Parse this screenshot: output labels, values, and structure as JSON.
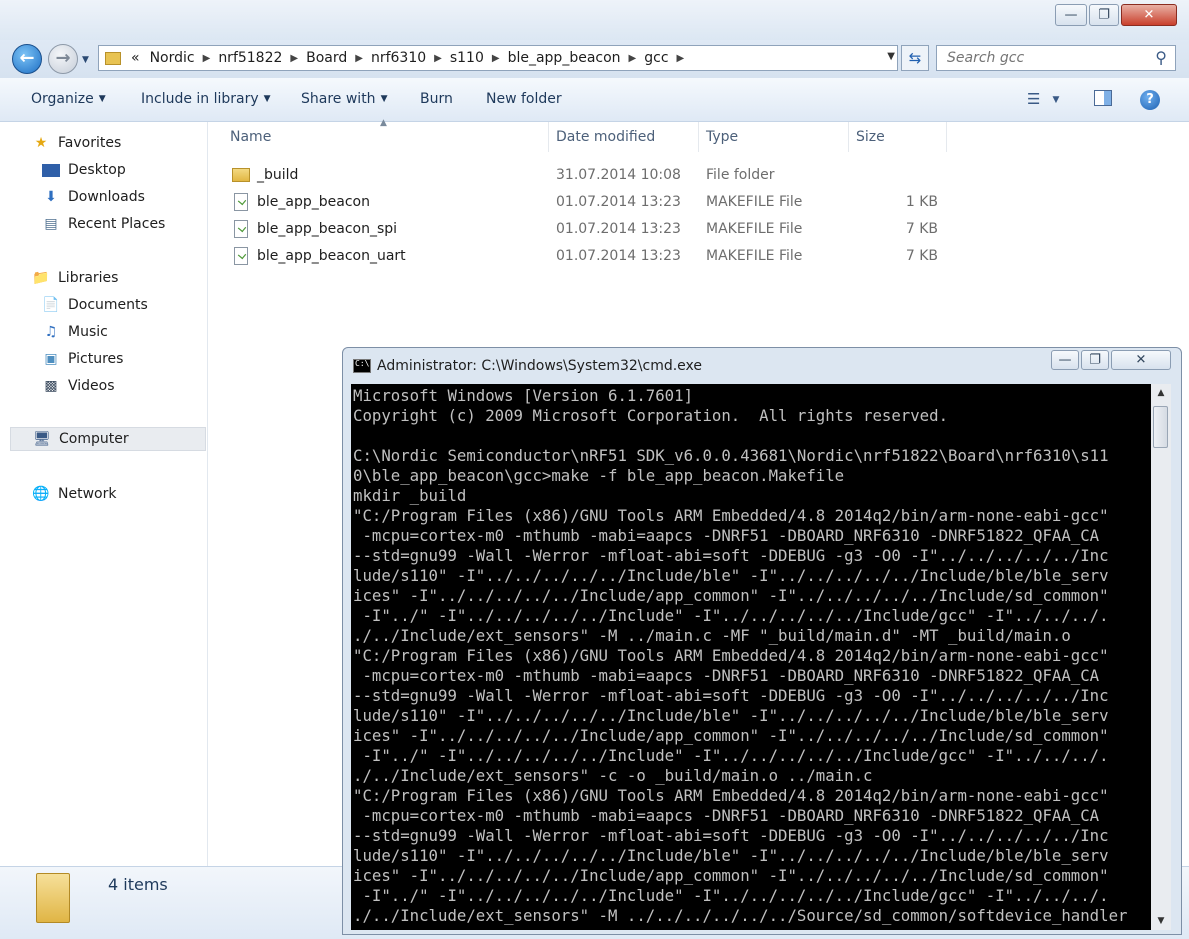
{
  "explorer": {
    "address_crumbs": [
      "Nordic",
      "nrf51822",
      "Board",
      "nrf6310",
      "s110",
      "ble_app_beacon",
      "gcc"
    ],
    "address_overflow": "«",
    "search_placeholder": "Search gcc",
    "toolbar": {
      "organize": "Organize",
      "include_in_library": "Include in library",
      "share_with": "Share with",
      "burn": "Burn",
      "new_folder": "New folder"
    },
    "nav": {
      "favorites": "Favorites",
      "desktop": "Desktop",
      "downloads": "Downloads",
      "recent_places": "Recent Places",
      "libraries": "Libraries",
      "documents": "Documents",
      "music": "Music",
      "pictures": "Pictures",
      "videos": "Videos",
      "computer": "Computer",
      "network": "Network"
    },
    "columns": {
      "name": "Name",
      "date_modified": "Date modified",
      "type": "Type",
      "size": "Size"
    },
    "files": [
      {
        "name": "_build",
        "date": "31.07.2014 10:08",
        "type": "File folder",
        "size": "",
        "icon": "folder-icon"
      },
      {
        "name": "ble_app_beacon",
        "date": "01.07.2014 13:23",
        "type": "MAKEFILE File",
        "size": "1 KB",
        "icon": "makefile-icon"
      },
      {
        "name": "ble_app_beacon_spi",
        "date": "01.07.2014 13:23",
        "type": "MAKEFILE File",
        "size": "7 KB",
        "icon": "makefile-icon"
      },
      {
        "name": "ble_app_beacon_uart",
        "date": "01.07.2014 13:23",
        "type": "MAKEFILE File",
        "size": "7 KB",
        "icon": "makefile-icon"
      }
    ],
    "item_count": "4 items"
  },
  "cmd": {
    "title": "Administrator: C:\\Windows\\System32\\cmd.exe",
    "lines": [
      "Microsoft Windows [Version 6.1.7601]",
      "Copyright (c) 2009 Microsoft Corporation.  All rights reserved.",
      "",
      "C:\\Nordic Semiconductor\\nRF51 SDK_v6.0.0.43681\\Nordic\\nrf51822\\Board\\nrf6310\\s11",
      "0\\ble_app_beacon\\gcc>make -f ble_app_beacon.Makefile",
      "mkdir _build",
      "\"C:/Program Files (x86)/GNU Tools ARM Embedded/4.8 2014q2/bin/arm-none-eabi-gcc\"",
      " -mcpu=cortex-m0 -mthumb -mabi=aapcs -DNRF51 -DBOARD_NRF6310 -DNRF51822_QFAA_CA",
      "--std=gnu99 -Wall -Werror -mfloat-abi=soft -DDEBUG -g3 -O0 -I\"../../../../../Inc",
      "lude/s110\" -I\"../../../../../Include/ble\" -I\"../../../../../Include/ble/ble_serv",
      "ices\" -I\"../../../../../Include/app_common\" -I\"../../../../../Include/sd_common\"",
      " -I\"../\" -I\"../../../../../Include\" -I\"../../../../../Include/gcc\" -I\"../../../.",
      "./../Include/ext_sensors\" -M ../main.c -MF \"_build/main.d\" -MT _build/main.o",
      "\"C:/Program Files (x86)/GNU Tools ARM Embedded/4.8 2014q2/bin/arm-none-eabi-gcc\"",
      " -mcpu=cortex-m0 -mthumb -mabi=aapcs -DNRF51 -DBOARD_NRF6310 -DNRF51822_QFAA_CA",
      "--std=gnu99 -Wall -Werror -mfloat-abi=soft -DDEBUG -g3 -O0 -I\"../../../../../Inc",
      "lude/s110\" -I\"../../../../../Include/ble\" -I\"../../../../../Include/ble/ble_serv",
      "ices\" -I\"../../../../../Include/app_common\" -I\"../../../../../Include/sd_common\"",
      " -I\"../\" -I\"../../../../../Include\" -I\"../../../../../Include/gcc\" -I\"../../../.",
      "./../Include/ext_sensors\" -c -o _build/main.o ../main.c",
      "\"C:/Program Files (x86)/GNU Tools ARM Embedded/4.8 2014q2/bin/arm-none-eabi-gcc\"",
      " -mcpu=cortex-m0 -mthumb -mabi=aapcs -DNRF51 -DBOARD_NRF6310 -DNRF51822_QFAA_CA",
      "--std=gnu99 -Wall -Werror -mfloat-abi=soft -DDEBUG -g3 -O0 -I\"../../../../../Inc",
      "lude/s110\" -I\"../../../../../Include/ble\" -I\"../../../../../Include/ble/ble_serv",
      "ices\" -I\"../../../../../Include/app_common\" -I\"../../../../../Include/sd_common\"",
      " -I\"../\" -I\"../../../../../Include\" -I\"../../../../../Include/gcc\" -I\"../../../.",
      "./../Include/ext_sensors\" -M ../../../../../../Source/sd_common/softdevice_handler"
    ]
  },
  "colors": {
    "accent": "#1e395b",
    "console_bg": "#000000",
    "console_fg": "#c0c0c0"
  }
}
